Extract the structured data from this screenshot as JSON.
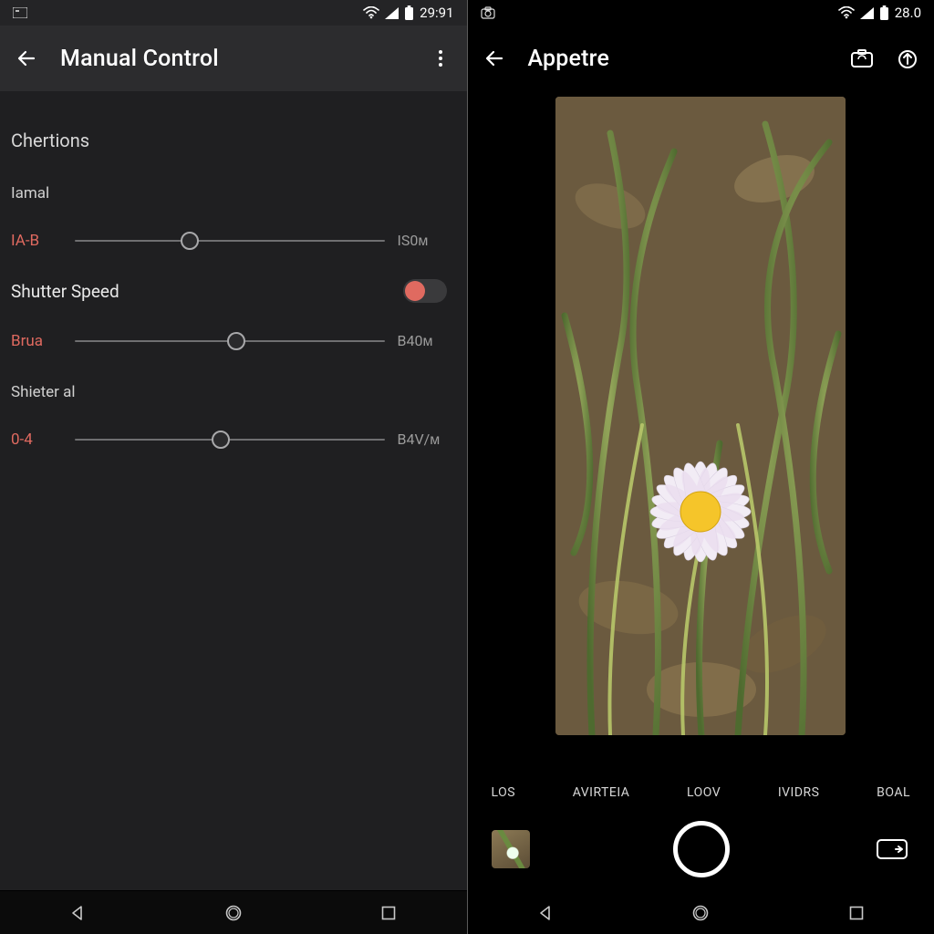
{
  "left": {
    "status": {
      "time": "29:91"
    },
    "appbar": {
      "title": "Manual Control"
    },
    "section": "Chertions",
    "sub1": "Iamal",
    "slider1": {
      "label": "IA-B",
      "value": "IS0ᴍ",
      "pos": 0.37
    },
    "shutter_label": "Shutter Speed",
    "slider2": {
      "label": "Brua",
      "value": "B40ᴍ",
      "pos": 0.52
    },
    "sub2": "Shieter al",
    "slider3": {
      "label": "0-4",
      "value": "B4V/ᴍ",
      "pos": 0.47
    }
  },
  "right": {
    "status": {
      "time": "28.0"
    },
    "appbar": {
      "title": "Appetre"
    },
    "modes": [
      "LOS",
      "AVIRTEIA",
      "LOOV",
      "IVIDRS",
      "BOAL"
    ]
  }
}
